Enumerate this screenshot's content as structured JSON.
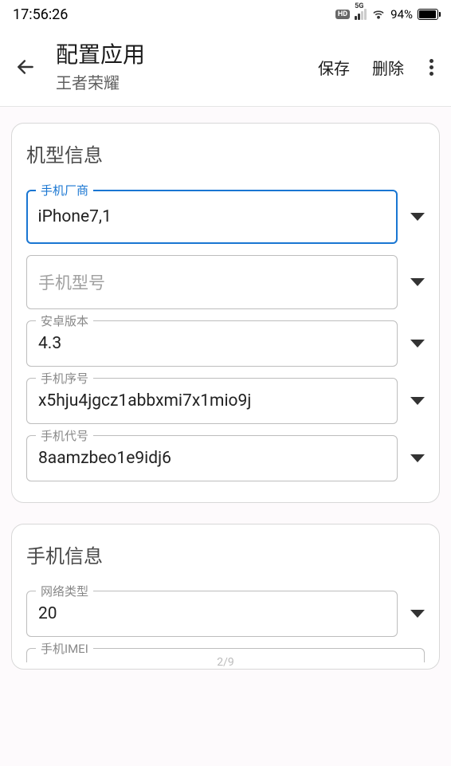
{
  "status": {
    "time": "17:56:26",
    "hd": "HD",
    "network": "5G",
    "battery_pct": "94%"
  },
  "appbar": {
    "title": "配置应用",
    "subtitle": "王者荣耀",
    "save": "保存",
    "delete": "删除"
  },
  "section_device": {
    "title": "机型信息",
    "fields": {
      "manufacturer": {
        "label": "手机厂商",
        "value": "iPhone7,1"
      },
      "model": {
        "label": "手机型号",
        "value": ""
      },
      "android_version": {
        "label": "安卓版本",
        "value": "4.3"
      },
      "serial": {
        "label": "手机序号",
        "value": "x5hju4jgcz1abbxmi7x1mio9j"
      },
      "codename": {
        "label": "手机代号",
        "value": "8aamzbeo1e9idj6"
      }
    }
  },
  "section_phone": {
    "title": "手机信息",
    "fields": {
      "network_type": {
        "label": "网络类型",
        "value": "20"
      },
      "imei": {
        "label": "手机IMEI",
        "value": ""
      }
    }
  },
  "pager": "2/9"
}
